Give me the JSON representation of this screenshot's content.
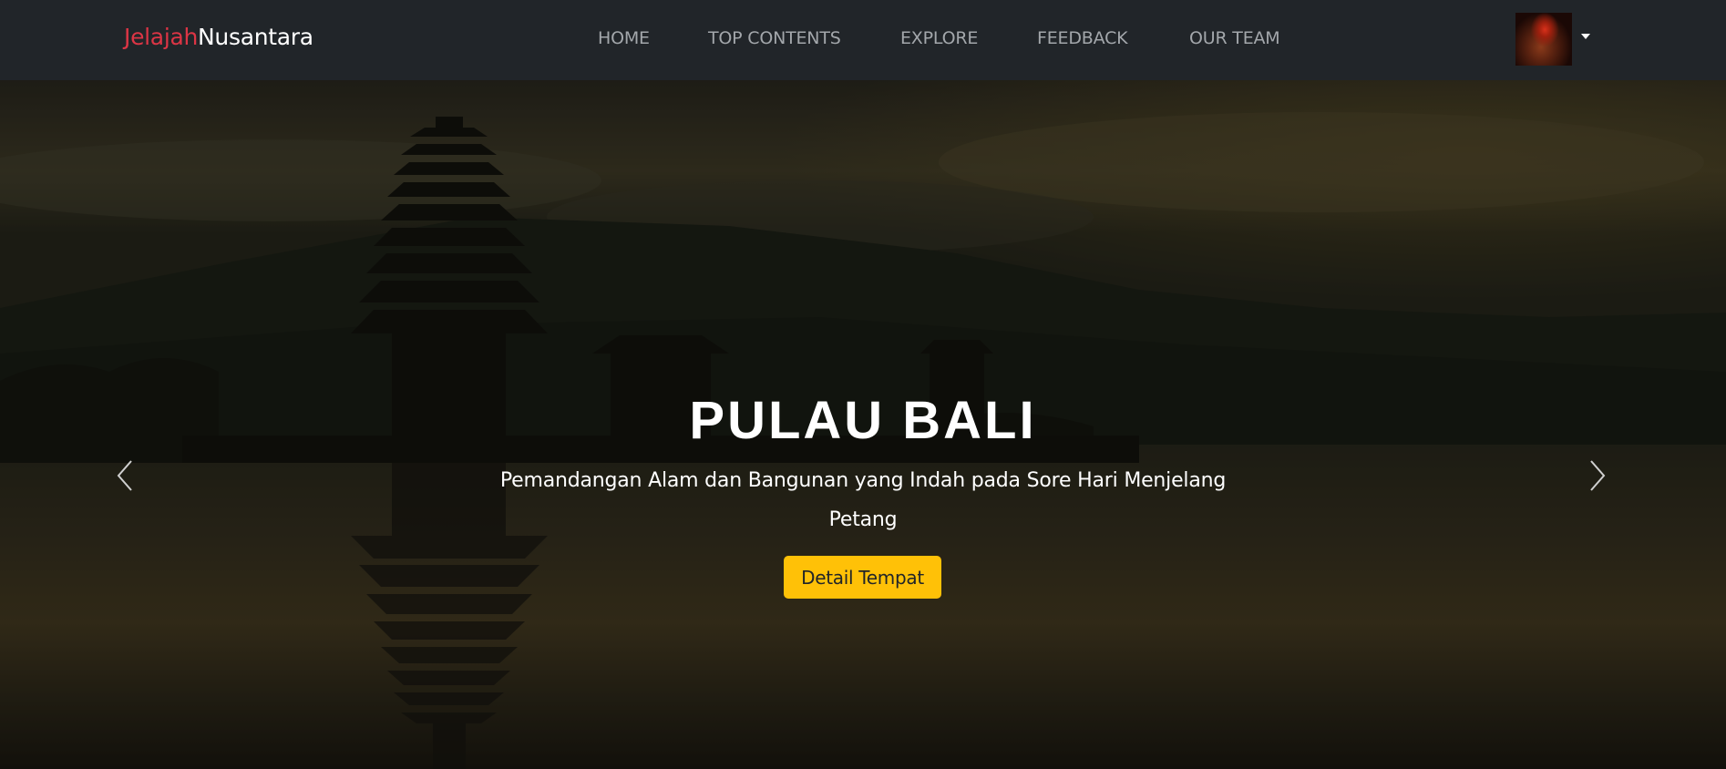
{
  "brand": {
    "part1": "Jelajah",
    "part2": "Nusantara"
  },
  "nav": {
    "items": [
      {
        "label": "HOME"
      },
      {
        "label": "TOP CONTENTS"
      },
      {
        "label": "EXPLORE"
      },
      {
        "label": "FEEDBACK"
      },
      {
        "label": "OUR TEAM"
      }
    ]
  },
  "profile": {
    "icon": "avatar-image",
    "dropdown_icon": "caret-down-icon"
  },
  "hero": {
    "title": "PULAU BALI",
    "subtitle": "Pemandangan Alam dan Bangunan yang Indah pada Sore Hari Menjelang Petang",
    "button_label": "Detail Tempat",
    "prev_icon": "chevron-left-icon",
    "next_icon": "chevron-right-icon"
  },
  "colors": {
    "navbar_bg": "#212529",
    "brand_accent": "#dc3545",
    "nav_text": "#a3a7ab",
    "button_bg": "#ffc107"
  }
}
